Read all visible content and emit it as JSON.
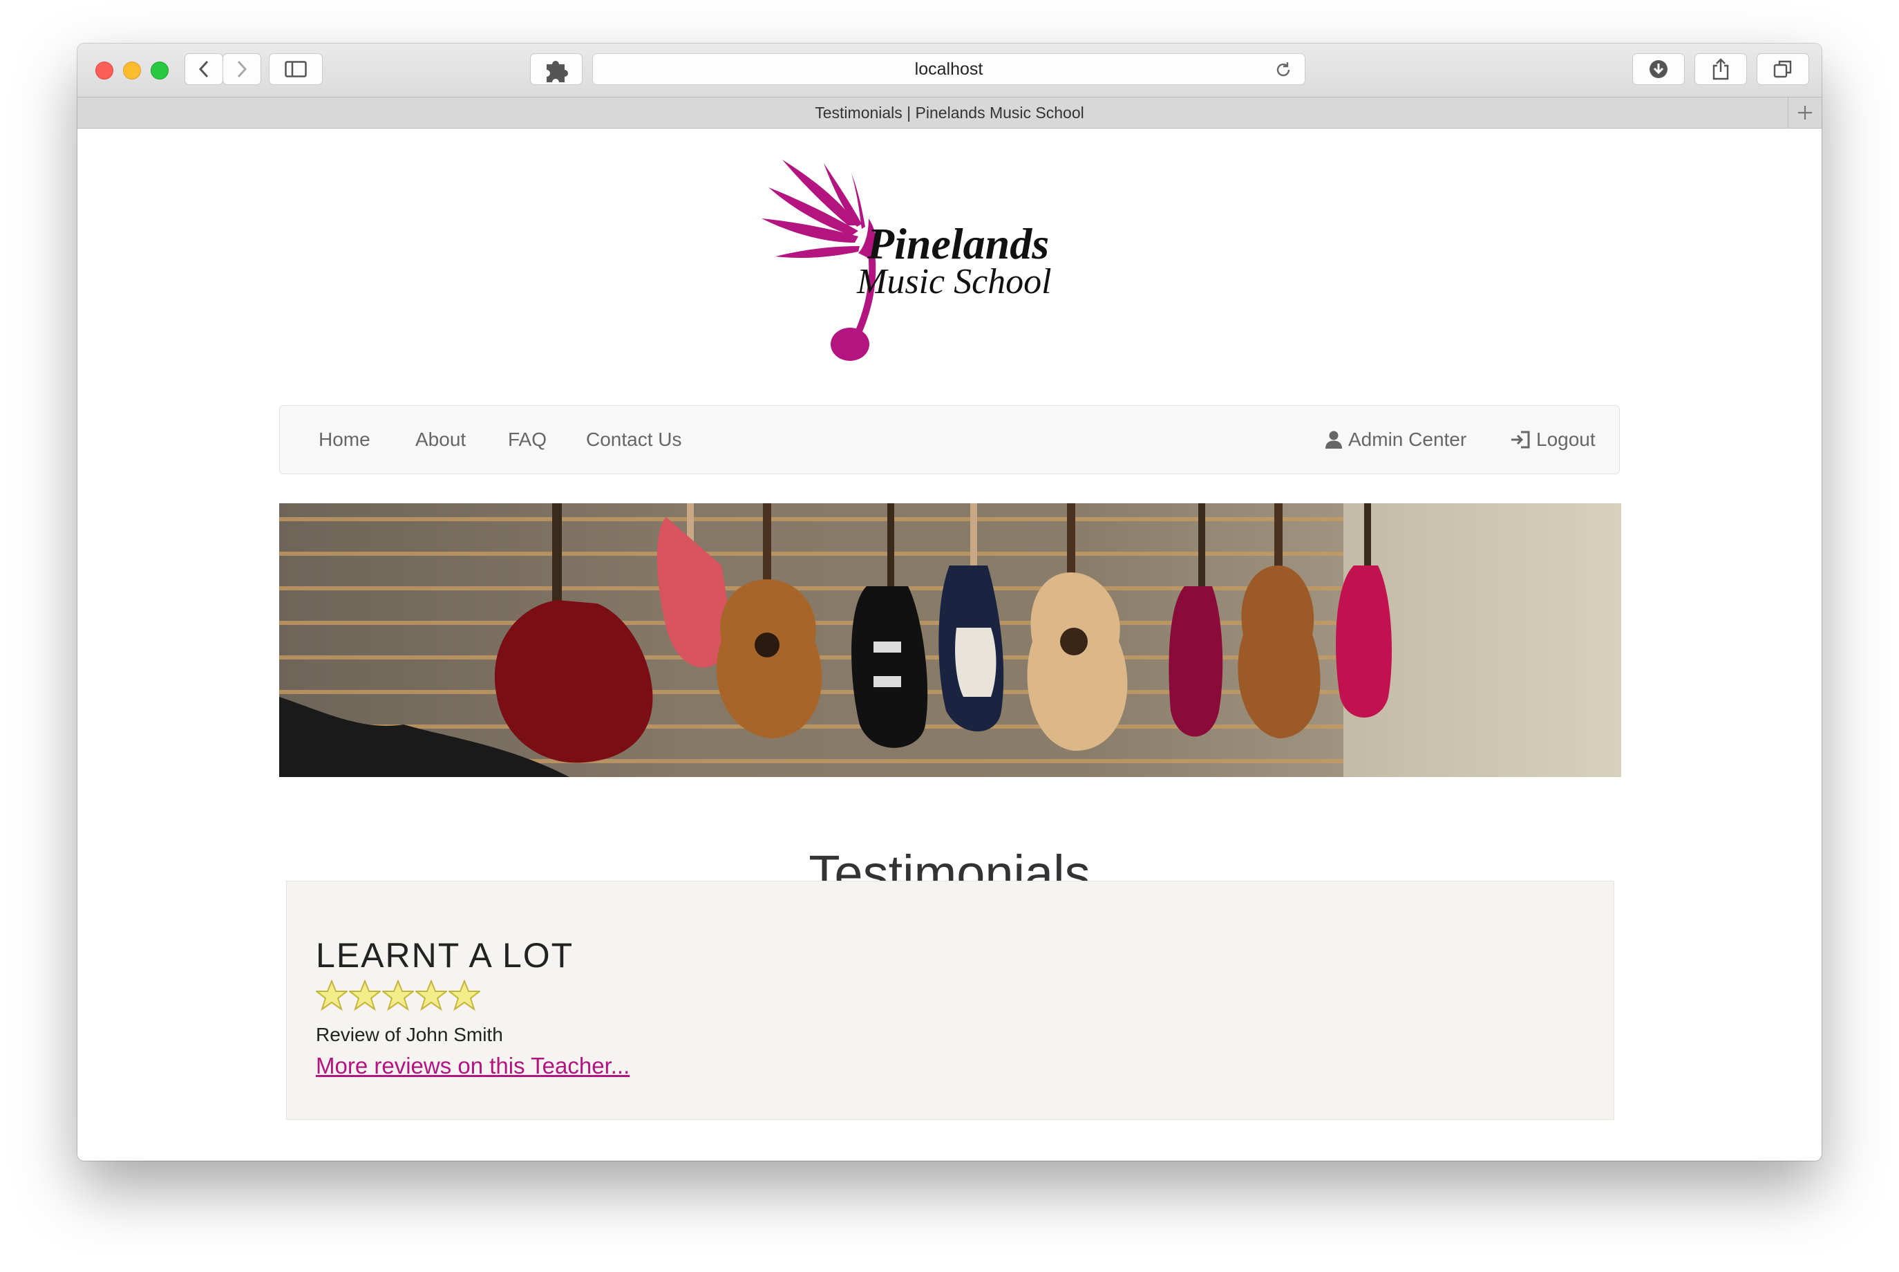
{
  "browser": {
    "url": "localhost",
    "tab_title": "Testimonials | Pinelands Music School"
  },
  "logo": {
    "line1": "Pinelands",
    "line2": "Music School",
    "brand_color": "#b3147f"
  },
  "nav": {
    "home": "Home",
    "about": "About",
    "faq": "FAQ",
    "contact": "Contact Us",
    "admin": "Admin Center",
    "logout": "Logout"
  },
  "page": {
    "title": "Testimonials"
  },
  "reviews": [
    {
      "title": "LEARNT A LOT",
      "rating": 5,
      "max_rating": 5,
      "review_of": "Review of John Smith",
      "link": "More reviews on this Teacher..."
    }
  ],
  "icons": {
    "back": "chevron-left-icon",
    "forward": "chevron-right-icon",
    "sidebar": "sidebar-icon",
    "extension": "puzzle-icon",
    "reload": "reload-icon",
    "download": "download-icon",
    "share": "share-icon",
    "tabs": "tabs-icon",
    "new_tab": "plus-icon",
    "admin": "user-icon",
    "logout": "login-icon"
  }
}
